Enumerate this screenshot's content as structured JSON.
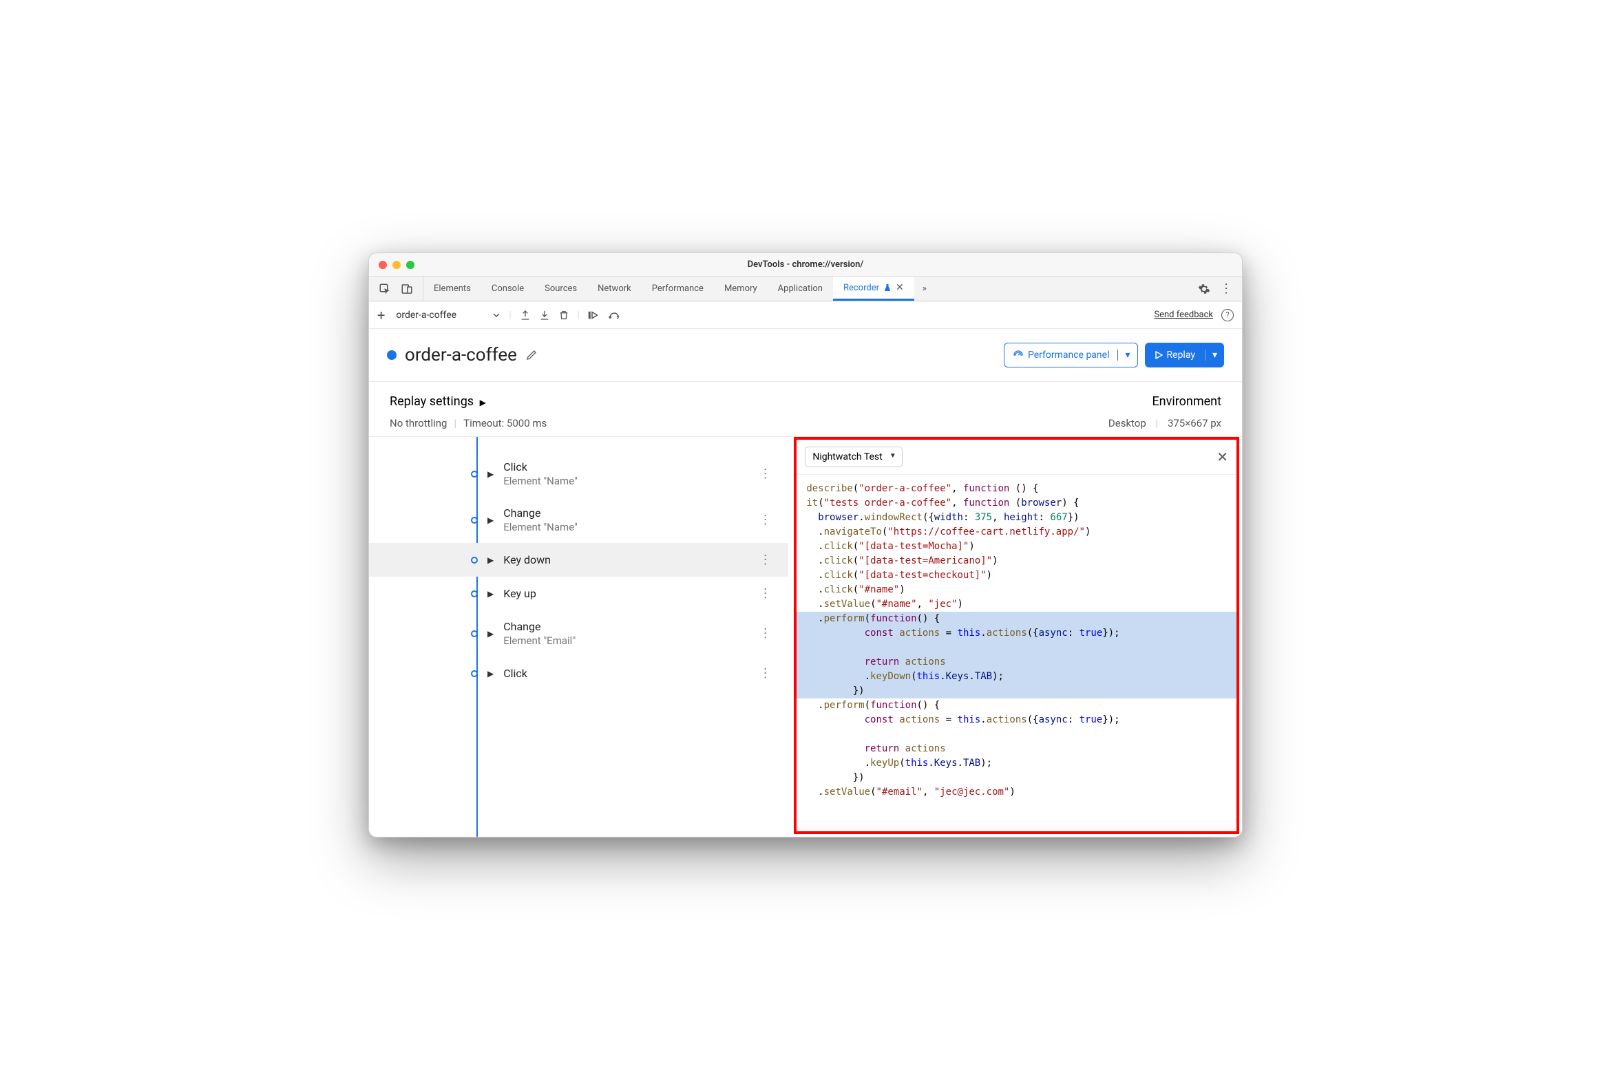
{
  "window": {
    "title": "DevTools - chrome://version/"
  },
  "tabs": [
    "Elements",
    "Console",
    "Sources",
    "Network",
    "Performance",
    "Memory",
    "Application",
    "Recorder"
  ],
  "active_tab": "Recorder",
  "recording_name": "order-a-coffee",
  "feedback_label": "Send feedback",
  "page_title": "order-a-coffee",
  "perf_button": "Performance panel",
  "replay_button": "Replay",
  "settings": {
    "heading": "Replay settings",
    "throttling": "No throttling",
    "timeout": "Timeout: 5000 ms",
    "env_heading": "Environment",
    "env_device": "Desktop",
    "env_size": "375×667 px"
  },
  "steps": [
    {
      "title": "Click",
      "sub": "Element \"Name\""
    },
    {
      "title": "Change",
      "sub": "Element \"Name\""
    },
    {
      "title": "Key down",
      "sub": "",
      "selected": true
    },
    {
      "title": "Key up",
      "sub": ""
    },
    {
      "title": "Change",
      "sub": "Element \"Email\""
    },
    {
      "title": "Click",
      "sub": ""
    }
  ],
  "code_panel": {
    "dropdown": "Nightwatch Test",
    "lines": [
      {
        "t": "describe(\"order-a-coffee\", function () {"
      },
      {
        "t": "it(\"tests order-a-coffee\", function (browser) {"
      },
      {
        "t": "  browser.windowRect({width: 375, height: 667})"
      },
      {
        "t": "  .navigateTo(\"https://coffee-cart.netlify.app/\")"
      },
      {
        "t": "  .click(\"[data-test=Mocha]\")"
      },
      {
        "t": "  .click(\"[data-test=Americano]\")"
      },
      {
        "t": "  .click(\"[data-test=checkout]\")"
      },
      {
        "t": "  .click(\"#name\")"
      },
      {
        "t": "  .setValue(\"#name\", \"jec\")"
      },
      {
        "t": "  .perform(function() {",
        "hl": true
      },
      {
        "t": "          const actions = this.actions({async: true});",
        "hl": true
      },
      {
        "t": "",
        "hl": true
      },
      {
        "t": "          return actions",
        "hl": true
      },
      {
        "t": "          .keyDown(this.Keys.TAB);",
        "hl": true
      },
      {
        "t": "        })",
        "hl": true
      },
      {
        "t": "  .perform(function() {"
      },
      {
        "t": "          const actions = this.actions({async: true});"
      },
      {
        "t": ""
      },
      {
        "t": "          return actions"
      },
      {
        "t": "          .keyUp(this.Keys.TAB);"
      },
      {
        "t": "        })"
      },
      {
        "t": "  .setValue(\"#email\", \"jec@jec.com\")"
      }
    ]
  }
}
